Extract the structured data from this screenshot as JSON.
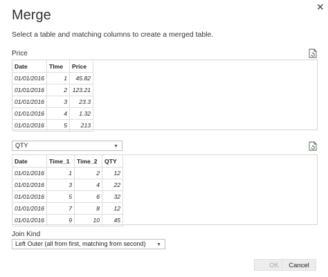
{
  "dialog": {
    "title": "Merge",
    "subtitle": "Select a table and matching columns to create a merged table.",
    "close_glyph": "✕"
  },
  "first_table": {
    "label": "Price",
    "columns": [
      "Date",
      "TIme",
      "Price"
    ],
    "rows": [
      [
        "01/01/2016",
        "1",
        "45.82"
      ],
      [
        "01/01/2016",
        "2",
        "123.21"
      ],
      [
        "01/01/2016",
        "3",
        "23.3"
      ],
      [
        "01/01/2016",
        "4",
        "1.32"
      ],
      [
        "01/01/2016",
        "5",
        "213"
      ]
    ],
    "icon": "file-refresh-icon"
  },
  "second_table": {
    "selected": "QTY",
    "columns": [
      "Date",
      "Time_1",
      "Time_2",
      "QTY"
    ],
    "rows": [
      [
        "01/01/2016",
        "1",
        "2",
        "12"
      ],
      [
        "01/01/2016",
        "3",
        "4",
        "22"
      ],
      [
        "01/01/2016",
        "5",
        "6",
        "32"
      ],
      [
        "01/01/2016",
        "7",
        "8",
        "12"
      ],
      [
        "01/01/2016",
        "9",
        "10",
        "45"
      ]
    ],
    "icon": "file-refresh-icon"
  },
  "join": {
    "label": "Join Kind",
    "selected": "Left Outer (all from first, matching from second)"
  },
  "buttons": {
    "ok": "OK",
    "cancel": "Cancel"
  },
  "colors": {
    "border": "#d6d6d6",
    "disabled_bg": "#ededed",
    "disabled_text": "#a8a8a8"
  }
}
